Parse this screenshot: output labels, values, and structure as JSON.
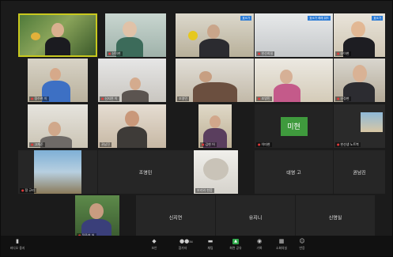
{
  "gallery": {
    "row1": [
      {
        "name": "",
        "active": true
      },
      {
        "name": "신이현"
      },
      {
        "name": "",
        "tag": "효소가"
      },
      {
        "name": "",
        "tag": "효소가 레레 워드"
      },
      {
        "name": "",
        "tag": "효소가"
      }
    ],
    "row1_names": [
      "",
      "신이현",
      "",
      "한선희밀",
      "신이현"
    ],
    "row2_names": [
      "정수현 이",
      "신지연 이",
      "조영민",
      "조영민",
      "신정현"
    ],
    "row3_names": [
      "고재준",
      "권남진",
      "김현 어",
      "이미현",
      "한선생 노트북"
    ],
    "row4_names": [
      "정 규리",
      "조영민",
      "보리와 현웅",
      "대영 고",
      "권남진"
    ],
    "row5_names": [
      "정주연 어",
      "신지연",
      "유지니",
      "신명일"
    ],
    "miheon": "미현"
  },
  "toolbar": {
    "audio": "비디오 중지",
    "security": "보안",
    "participants": "참가자",
    "participants_count": "34",
    "chat": "채팅",
    "share": "화면 공유",
    "record": "기록",
    "breakout": "소회의실",
    "reactions": "반응"
  },
  "colors": {
    "active_border": "#c8c81e",
    "tile_bg": "#262626",
    "toolbar_bg": "#111111",
    "share_green": "#2fa84a",
    "miheon_green": "#3f9a3d",
    "mic_muted": "#e03a3a"
  }
}
